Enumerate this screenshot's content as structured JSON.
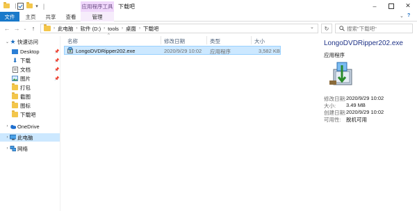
{
  "titlebar": {
    "context_tab": "应用程序工具",
    "window_title": "下载吧"
  },
  "ribbon": {
    "tab_file": "文件",
    "tab_home": "主页",
    "tab_share": "共享",
    "tab_view": "查看",
    "tab_manage": "管理"
  },
  "address": {
    "segments": [
      "此电脑",
      "软件 (D:)",
      "tools",
      "桌面",
      "下载吧"
    ],
    "search_placeholder": "搜索\"下载吧\""
  },
  "nav": {
    "quick_access": "快速访问",
    "items": [
      {
        "label": "Desktop",
        "pinned": true
      },
      {
        "label": "下载",
        "pinned": true
      },
      {
        "label": "文档",
        "pinned": true
      },
      {
        "label": "图片",
        "pinned": true
      },
      {
        "label": "打包",
        "pinned": false
      },
      {
        "label": "截图",
        "pinned": false
      },
      {
        "label": "图标",
        "pinned": false
      },
      {
        "label": "下载吧",
        "pinned": false
      }
    ],
    "onedrive": "OneDrive",
    "this_pc": "此电脑",
    "network": "网络"
  },
  "list": {
    "columns": [
      "名称",
      "修改日期",
      "类型",
      "大小"
    ],
    "rows": [
      {
        "name": "LongoDVDRipper202.exe",
        "modified": "2020/9/29 10:02",
        "type": "应用程序",
        "size": "3,582 KB"
      }
    ]
  },
  "details": {
    "filename": "LongoDVDRipper202.exe",
    "type": "应用程序",
    "props": [
      {
        "label": "修改日期:",
        "value": "2020/9/29 10:02"
      },
      {
        "label": "大小:",
        "value": "3.49 MB"
      },
      {
        "label": "创建日期:",
        "value": "2020/9/29 10:02"
      },
      {
        "label": "可用性:",
        "value": "脱机可用"
      }
    ]
  }
}
